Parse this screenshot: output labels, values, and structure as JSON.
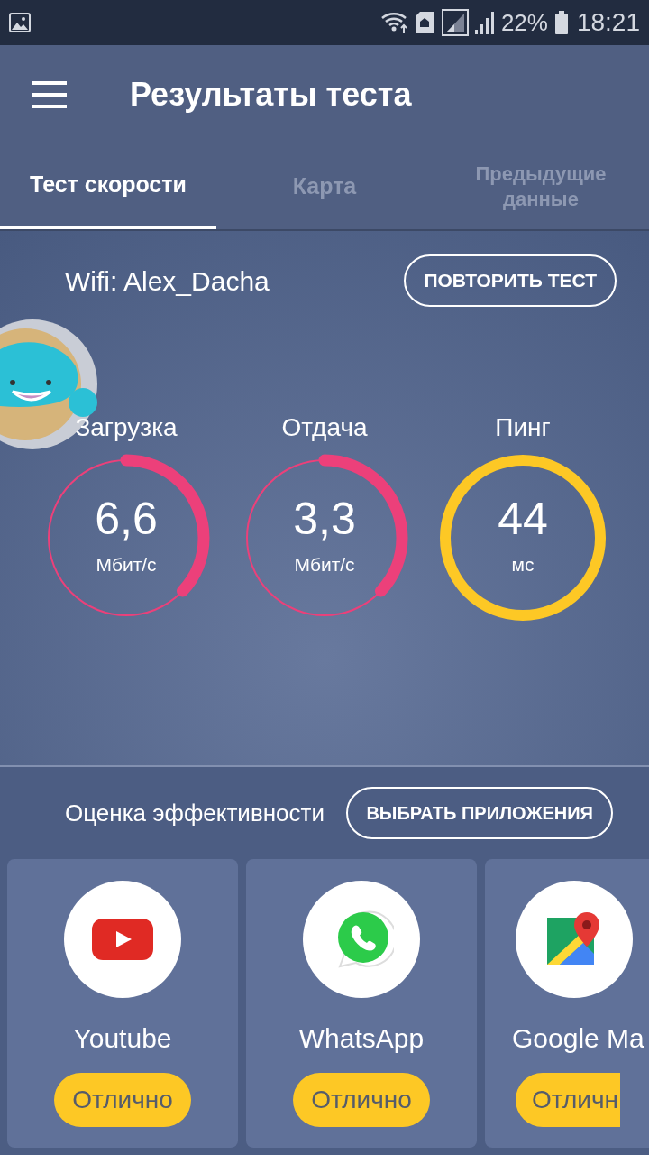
{
  "status_bar": {
    "battery": "22%",
    "time": "18:21"
  },
  "app_bar": {
    "title": "Результаты теста"
  },
  "tabs": [
    {
      "label": "Тест скорости",
      "selected": true
    },
    {
      "label": "Карта",
      "selected": false
    },
    {
      "label": "Предыдущие данные",
      "selected": false
    }
  ],
  "network": {
    "label": "Wifi: Alex_Dacha",
    "button": "ПОВТОРИТЬ ТЕСТ"
  },
  "gauges": [
    {
      "label": "Загрузка",
      "value": "6,6",
      "unit": "Мбит/с",
      "level": 0.37,
      "color": "#ec407a"
    },
    {
      "label": "Отдача",
      "value": "3,3",
      "unit": "Мбит/с",
      "level": 0.37,
      "color": "#ec407a"
    },
    {
      "label": "Пинг",
      "value": "44",
      "unit": "мс",
      "color": "#fdc825"
    }
  ],
  "performance": {
    "title": "Оценка эффективности",
    "button": "ВЫБРАТЬ ПРИЛОЖЕНИЯ"
  },
  "apps": [
    {
      "kind": "youtube",
      "name": "Youtube",
      "rating": "Отлично"
    },
    {
      "kind": "whatsapp",
      "name": "WhatsApp",
      "rating": "Отлично"
    },
    {
      "kind": "maps",
      "name": "Google Ma",
      "rating": "Отличн"
    }
  ]
}
